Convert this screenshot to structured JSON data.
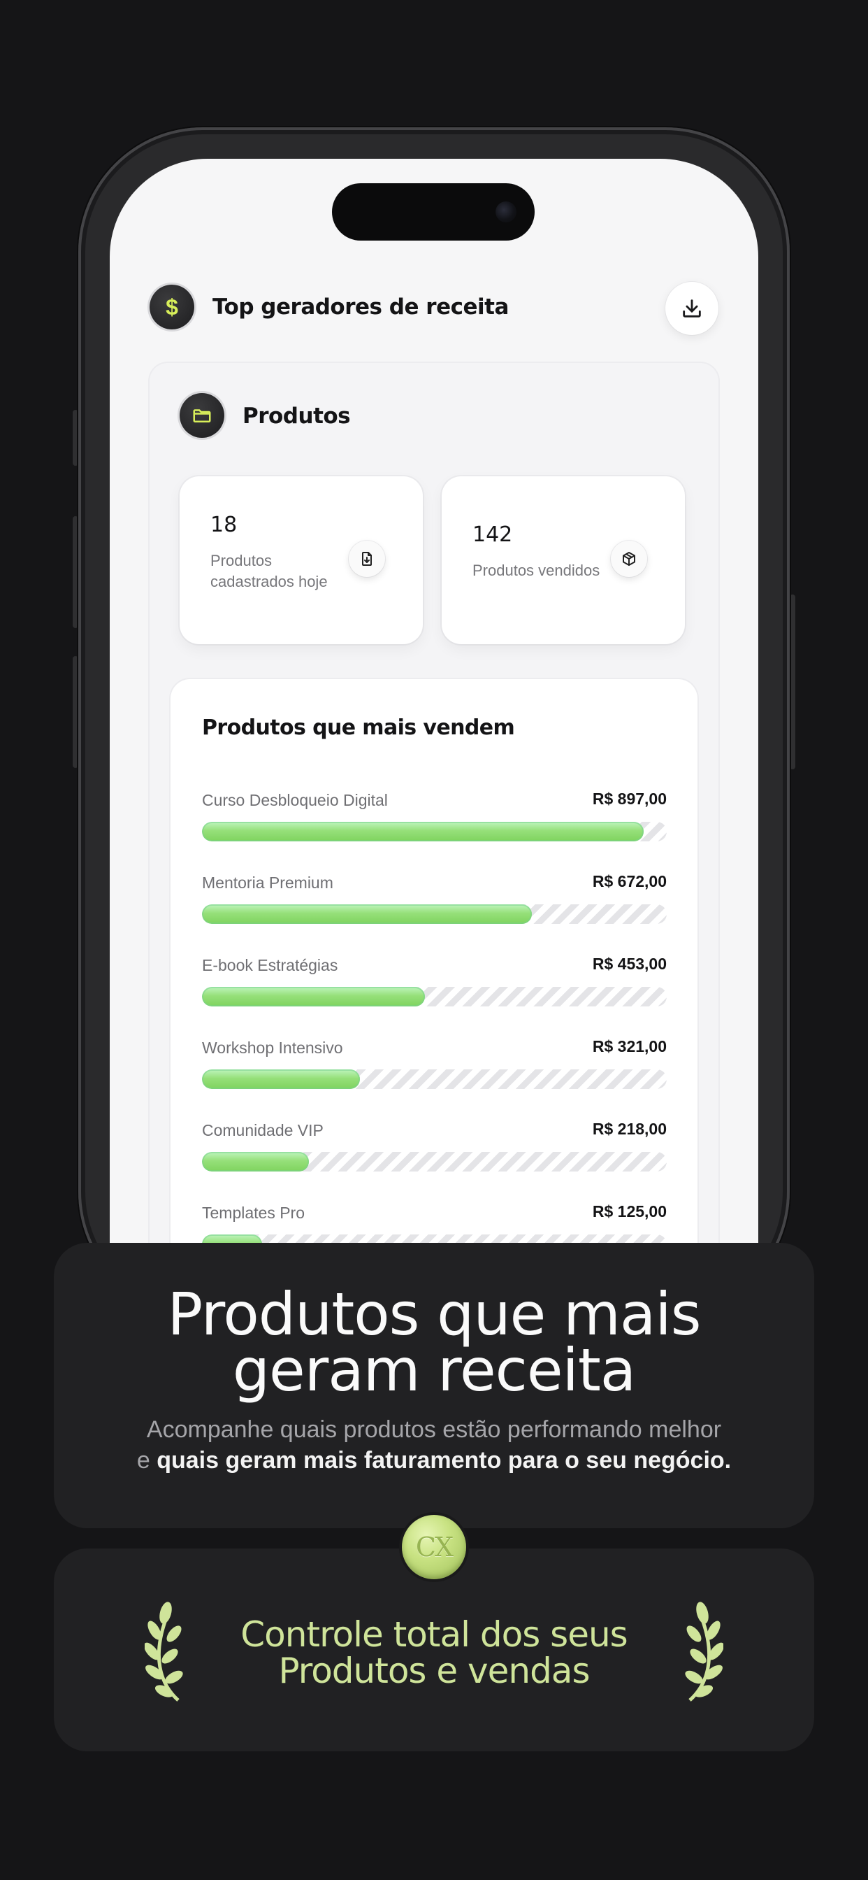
{
  "header": {
    "badge_symbol": "$",
    "title": "Top geradores de receita",
    "download_icon": "download-icon"
  },
  "products_section": {
    "title": "Produtos",
    "icon": "folder-icon",
    "stats": [
      {
        "value": "18",
        "label": "Produtos cadastrados hoje",
        "icon": "file-download-icon"
      },
      {
        "value": "142",
        "label": "Produtos vendidos",
        "icon": "box-icon"
      }
    ]
  },
  "top_sellers": {
    "title": "Produtos que mais vendem",
    "items": [
      {
        "name": "Curso Desbloqueio Digital",
        "value": "R$ 897,00",
        "fill": 0.95
      },
      {
        "name": "Mentoria Premium",
        "value": "R$ 672,00",
        "fill": 0.71
      },
      {
        "name": "E-book Estratégias",
        "value": "R$ 453,00",
        "fill": 0.48
      },
      {
        "name": "Workshop Intensivo",
        "value": "R$ 321,00",
        "fill": 0.34
      },
      {
        "name": "Comunidade VIP",
        "value": "R$ 218,00",
        "fill": 0.23
      },
      {
        "name": "Templates Pro",
        "value": "R$ 125,00",
        "fill": 0.13
      }
    ]
  },
  "promo": {
    "title_line1": "Produtos que mais",
    "title_line2": "geram receita",
    "subtitle_plain1": "Acompanhe quais produtos estão performando melhor",
    "subtitle_plain2": "e ",
    "subtitle_bold": "quais geram mais faturamento para o seu negócio."
  },
  "award": {
    "coin_text": "CX",
    "line1": "Controle total dos seus",
    "line2": "Produtos e vendas"
  },
  "colors": {
    "background": "#151517",
    "accent_green": "#96e07a",
    "award_text": "#cfe49a",
    "badge_yellow": "#d8ef5a"
  }
}
